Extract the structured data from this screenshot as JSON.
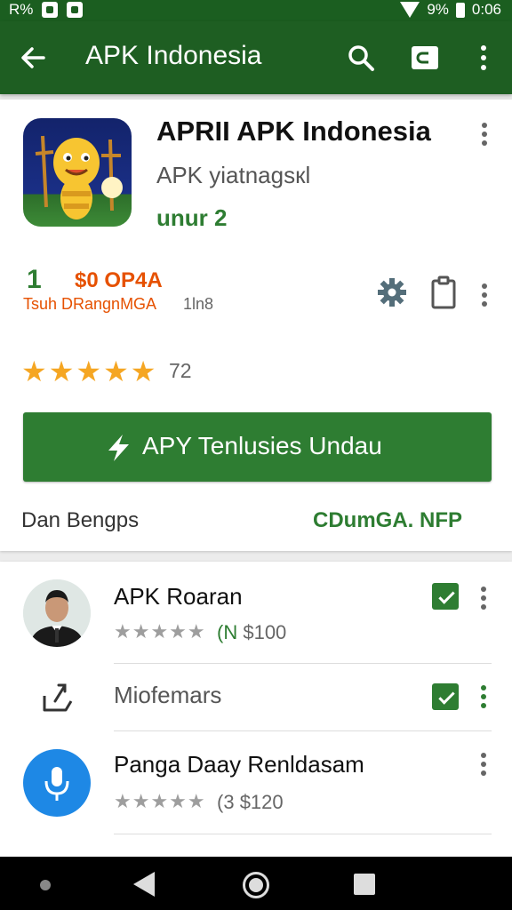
{
  "status_bar": {
    "left_text": "R%",
    "right_text": "9%",
    "time": "0:06"
  },
  "app_bar": {
    "title": "APK Indonesia"
  },
  "app": {
    "title": "APRII APK Indonesia",
    "developer": "APK yiatnagsкl",
    "badge": "unur 2",
    "stat_number": "1",
    "stat_price": "$0 OP4A",
    "stat_sub": "Tsuh DRangnMGA",
    "stat_sub2": "1ln8",
    "rating_count": "72",
    "install_label": "APY Tenlusies Undau",
    "footer_left": "Dan Bengps",
    "footer_right": "CDumGA. NFP"
  },
  "list": [
    {
      "title": "APK Roaran",
      "meta_prefix": "(N",
      "meta_price": "$100"
    },
    {
      "title": "Miofemars"
    },
    {
      "title": "Panga Daay Renldasam",
      "meta_prefix": "(3",
      "meta_price": "$120"
    }
  ],
  "icons": {
    "back": "arrow-left-icon",
    "search": "search-icon",
    "cast": "cast-icon",
    "more": "more-vert-icon",
    "settings": "gear-icon",
    "clipboard": "clipboard-icon",
    "bolt": "bolt-icon",
    "share": "share-icon",
    "chat": "chat-icon",
    "mic": "mic-icon"
  },
  "colors": {
    "primary": "#1e5e22",
    "accent": "#2e7d32",
    "star": "#f5a623",
    "price": "#e65100",
    "mic": "#1e88e5"
  }
}
